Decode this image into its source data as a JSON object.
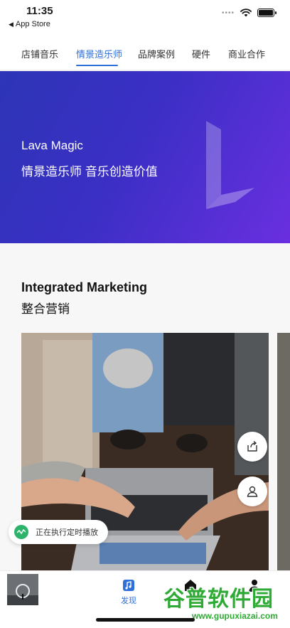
{
  "status_bar": {
    "time": "11:35",
    "back_label": "App Store"
  },
  "tabs": [
    {
      "label": "店铺音乐"
    },
    {
      "label": "情景造乐师"
    },
    {
      "label": "品牌案例"
    },
    {
      "label": "硬件"
    },
    {
      "label": "商业合作"
    }
  ],
  "active_tab": "情景造乐师",
  "banner": {
    "title": "Lava Magic",
    "subtitle": "情景造乐师 音乐创造价值"
  },
  "section": {
    "title_en": "Integrated Marketing",
    "title_zh": "整合营销"
  },
  "toast": {
    "text": "正在执行定时播放"
  },
  "bottom_nav": {
    "discover_label": "发现"
  },
  "watermark": {
    "title": "谷普软件园",
    "url": "www.gupuxiazai.com"
  },
  "colors": {
    "accent": "#2f6fd8",
    "banner_start": "#2d35b6",
    "banner_end": "#6a2fe0",
    "toast_icon": "#2db36a",
    "watermark": "#2faa34"
  }
}
